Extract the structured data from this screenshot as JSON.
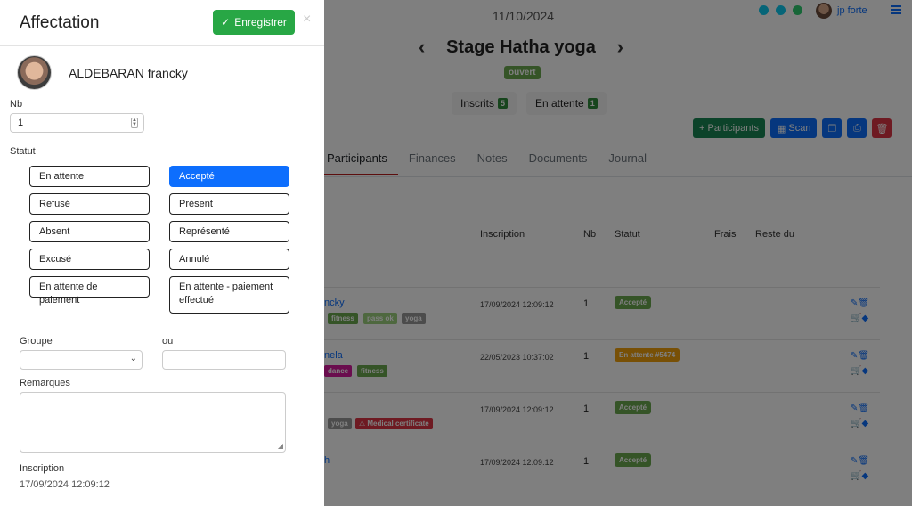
{
  "background": {
    "date": "11/10/2024",
    "title": "Stage Hatha yoga",
    "status": "ouvert",
    "counts": [
      {
        "label": "Inscrits",
        "value": "5"
      },
      {
        "label": "En attente",
        "value": "1"
      }
    ],
    "actions": {
      "participants": "+ Participants",
      "scan": "Scan"
    },
    "user_label": "jp forte",
    "tabs": [
      "Participants",
      "Finances",
      "Notes",
      "Documents",
      "Journal"
    ],
    "table_headers": {
      "inscription": "Inscription",
      "nb": "Nb",
      "statut": "Statut",
      "frais": "Frais",
      "reste": "Reste du"
    },
    "rows": [
      {
        "name": "ncky",
        "date": "17/09/2024 12:09:12",
        "nb": "1",
        "status": "Accepté"
      },
      {
        "name": "nela",
        "date": "22/05/2023 10:37:02",
        "nb": "1",
        "status": "En attente #5474"
      },
      {
        "name": "",
        "date": "17/09/2024 12:09:12",
        "nb": "1",
        "status": "Accepté"
      },
      {
        "name": "h",
        "date": "17/09/2024 12:09:12",
        "nb": "1",
        "status": "Accepté"
      }
    ],
    "tags": {
      "fitness": "fitness",
      "pass": "pass ok",
      "yoga": "yoga",
      "dance": "dance",
      "med": "⚠ Medical certificate"
    }
  },
  "panel": {
    "title": "Affectation",
    "save_label": "Enregistrer",
    "close": "×",
    "person_name": "ALDEBARAN francky",
    "nb_label": "Nb",
    "nb_value": "1",
    "statut_label": "Statut",
    "statuses": [
      "En attente",
      "Accepté",
      "Refusé",
      "Présent",
      "Absent",
      "Représenté",
      "Excusé",
      "Annulé",
      "En attente de paiement",
      "En attente - paiement effectué"
    ],
    "selected_status": "Accepté",
    "groupe_label": "Groupe",
    "ou_label": "ou",
    "remarques_label": "Remarques",
    "inscription_label": "Inscription",
    "inscription_value": "17/09/2024 12:09:12"
  },
  "colors": {
    "accent": "#0d6efd",
    "success": "#28a745",
    "danger": "#dc3545"
  }
}
